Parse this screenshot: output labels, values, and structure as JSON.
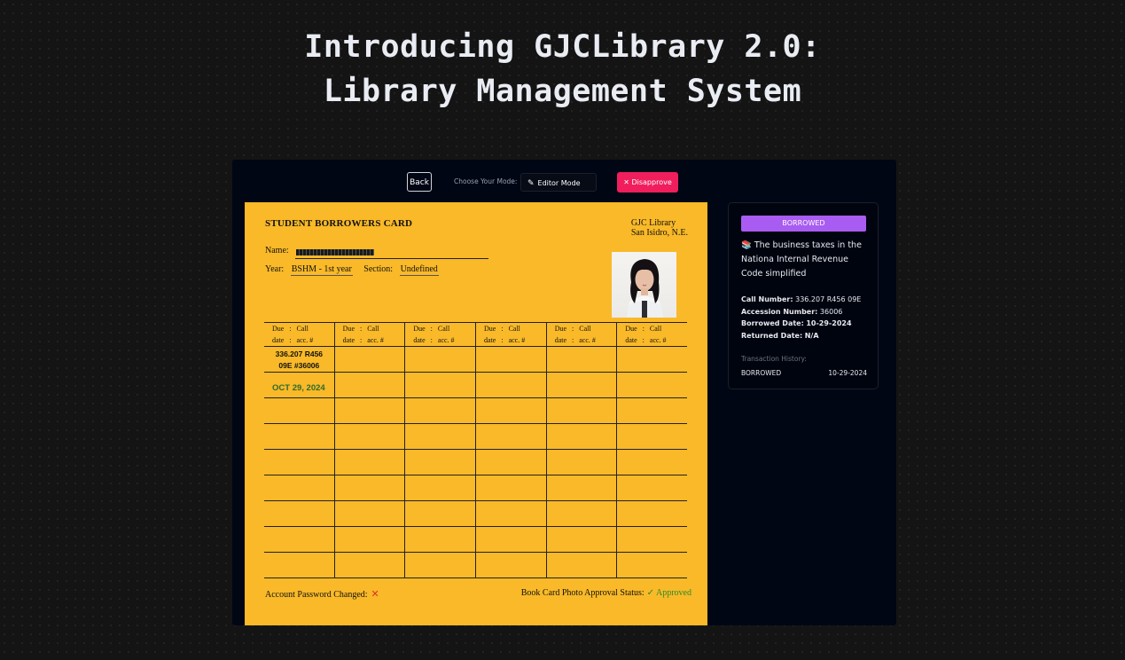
{
  "hero": {
    "title_line1": "Introducing GJCLibrary 2.0:",
    "title_line2": "Library Management System"
  },
  "toolbar": {
    "back_label": "Back",
    "mode_label": "Choose Your Mode:",
    "mode_value": "Editor Mode",
    "mode_icon": "pencil-icon",
    "disapprove_label": "✕ Disapprove",
    "disapprove_color": "#f01e5c"
  },
  "card": {
    "title": "STUDENT BORROWERS CARD",
    "library_line1": "GJC Library",
    "library_line2": "San Isidro, N.E.",
    "name_label": "Name:",
    "year_label": "Year:",
    "year_value": "BSHM - 1st year",
    "section_label": "Section:",
    "section_value": "Undefined",
    "background_color": "#f9b928",
    "column_header": "Due   :   Call\ndate   :   acc. #",
    "entry": {
      "call_line1": "336.207 R456",
      "call_line2": "09E #36006",
      "due_date": "OCT 29, 2024"
    },
    "footer_left": "Account Password Changed:",
    "footer_left_mark": "✕",
    "footer_right": "Book Card Photo Approval Status:",
    "footer_right_status": "✓ Approved"
  },
  "side_panel": {
    "status": "BORROWED",
    "status_color": "#a95cf1",
    "book_title": "📚 The business taxes in the Nationa Internal Revenue Code simplified",
    "call_number_label": "Call Number:",
    "call_number": "336.207 R456 09E",
    "accession_label": "Accession Number:",
    "accession": "36006",
    "borrowed_label": "Borrowed Date:",
    "borrowed_date": "10-29-2024",
    "returned_label": "Returned Date:",
    "returned_date": "N/A",
    "history_label": "Transaction History:",
    "history": [
      {
        "status": "BORROWED",
        "date": "10-29-2024"
      }
    ]
  }
}
